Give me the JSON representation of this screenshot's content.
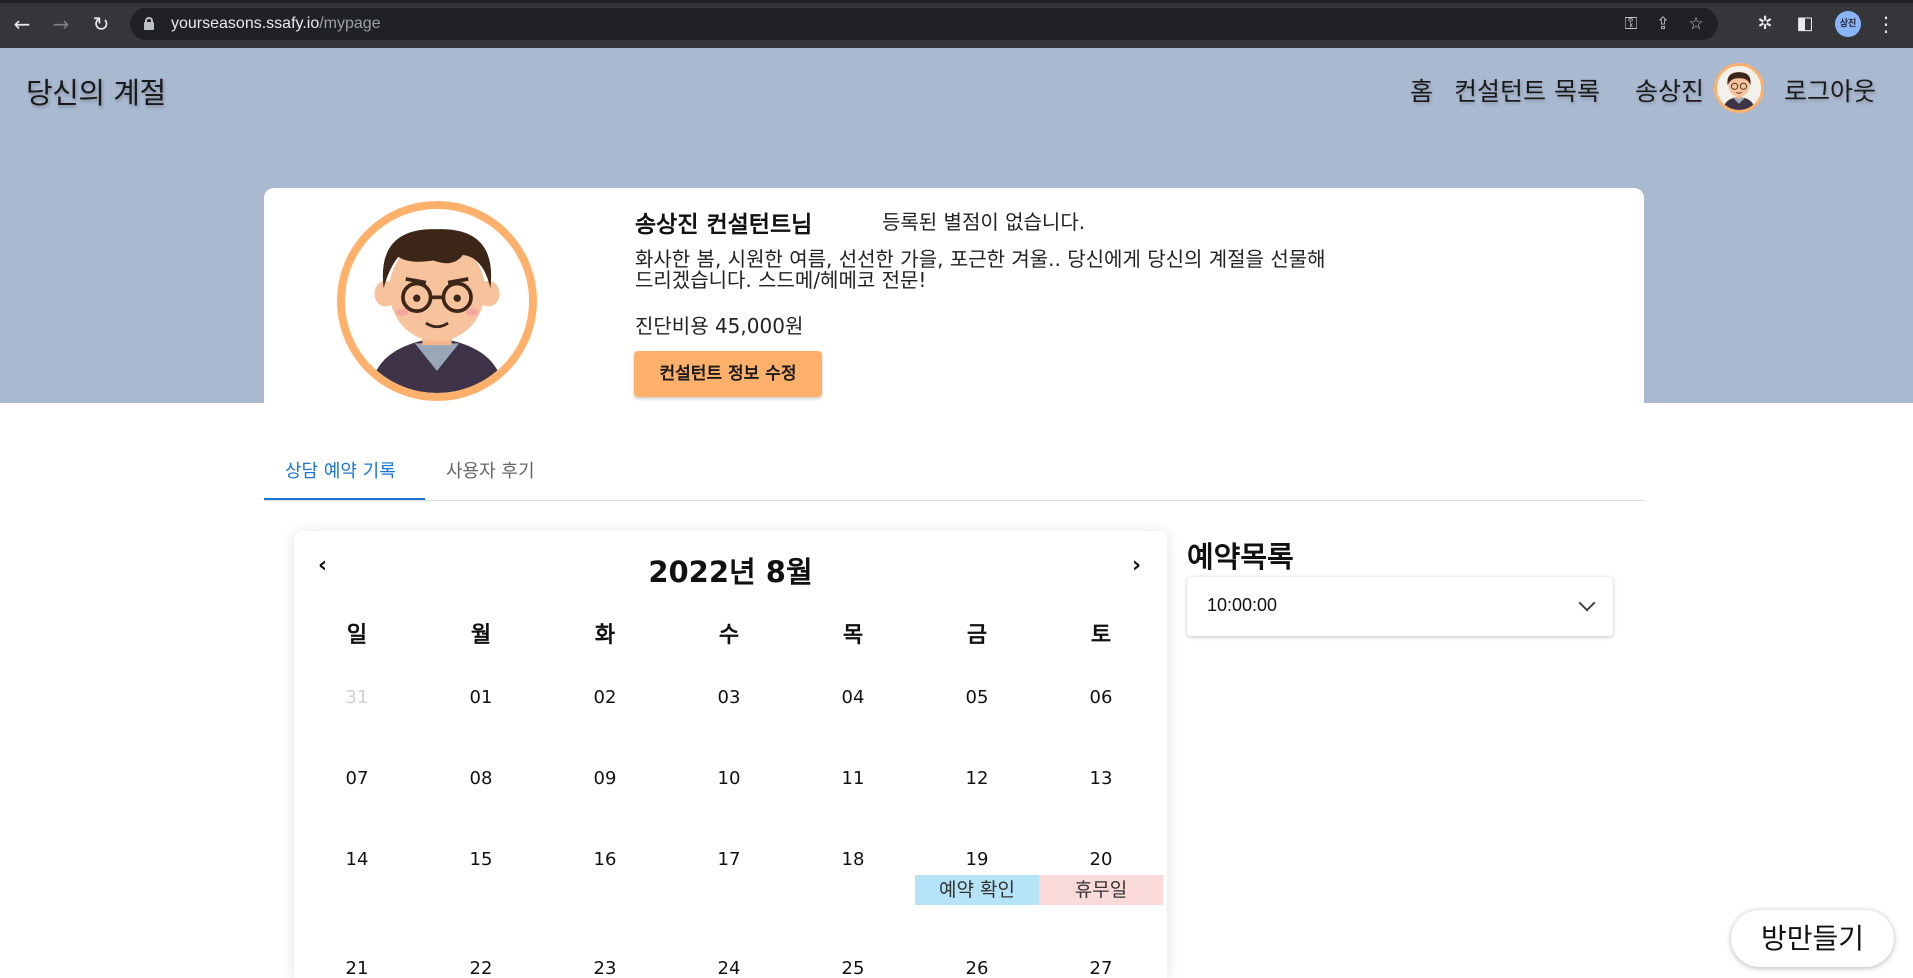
{
  "browser": {
    "url_host": "yourseasons.ssafy.io",
    "url_path": "/mypage",
    "profile_label": "상진"
  },
  "header": {
    "brand": "당신의 계절",
    "nav_home": "홈",
    "nav_consultants": "컨설턴트 목록",
    "nav_user": "송상진",
    "nav_logout": "로그아웃"
  },
  "profile": {
    "name": "송상진 컨설턴트님",
    "rating_text": "등록된 별점이 없습니다.",
    "intro_line1": "화사한 봄, 시원한 여름, 선선한 가을, 포근한 겨울.. 당신에게 당신의 계절을 선물해",
    "intro_line2": "드리겠습니다. 스드메/헤메코 전문!",
    "fee": "진단비용 45,000원",
    "edit_button": "컨설턴트 정보 수정"
  },
  "tabs": [
    {
      "label": "상담 예약 기록",
      "active": true
    },
    {
      "label": "사용자 후기",
      "active": false
    }
  ],
  "calendar": {
    "prev": "‹",
    "next": "›",
    "title": "2022년 8월",
    "weekdays": [
      "일",
      "월",
      "화",
      "수",
      "목",
      "금",
      "토"
    ],
    "weeks": [
      [
        "31",
        "01",
        "02",
        "03",
        "04",
        "05",
        "06"
      ],
      [
        "07",
        "08",
        "09",
        "10",
        "11",
        "12",
        "13"
      ],
      [
        "14",
        "15",
        "16",
        "17",
        "18",
        "19",
        "20"
      ],
      [
        "21",
        "22",
        "23",
        "24",
        "25",
        "26",
        "27"
      ]
    ],
    "booking_tag": "예약 확인",
    "holiday_tag": "휴무일"
  },
  "reservations": {
    "title": "예약목록",
    "selected": "10:00:00"
  },
  "fab": {
    "label": "방만들기"
  },
  "colors": {
    "hero_bg": "#a9b9d0",
    "accent": "#ffb06b",
    "tab_active": "#1976d2",
    "booking": "#b5e3f7",
    "holiday": "#fbdada"
  }
}
